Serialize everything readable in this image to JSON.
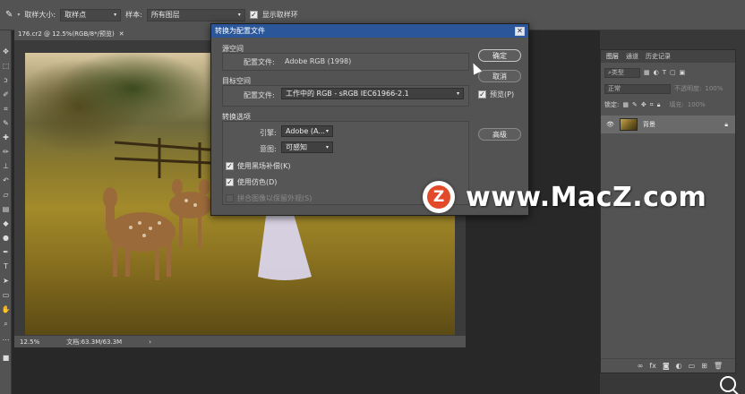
{
  "options_bar": {
    "sample_size_label": "取样大小:",
    "sample_size_value": "取样点",
    "sample_label": "样本:",
    "sample_value": "所有图层",
    "show_ring_label": "显示取样环"
  },
  "document": {
    "tab_title": "176.cr2 @ 12.5%(RGB/8*/预览)",
    "zoom": "12.5%",
    "doc_info": "文档:63.3M/63.3M"
  },
  "dialog": {
    "title": "转换为配置文件",
    "source_group": "源空间",
    "source_profile_label": "配置文件:",
    "source_profile_value": "Adobe RGB (1998)",
    "target_group": "目标空间",
    "target_profile_label": "配置文件:",
    "target_profile_value": "工作中的 RGB - sRGB IEC61966-2.1",
    "options_group": "转换选项",
    "engine_label": "引擎:",
    "engine_value": "Adobe (A...",
    "intent_label": "意图:",
    "intent_value": "可感知",
    "use_bpc": "使用黑场补偿(K)",
    "use_dither": "使用仿色(D)",
    "flatten": "拼合图像以保留外观(S)",
    "ok": "确定",
    "cancel": "取消",
    "preview": "预览(P)",
    "advanced": "高级"
  },
  "layers_panel": {
    "tabs": [
      "图层",
      "通道",
      "历史记录"
    ],
    "filter_kind": "类型",
    "blend_mode": "正常",
    "opacity_label": "不透明度:",
    "opacity_value": "100%",
    "lock_label": "锁定:",
    "fill_label": "填充:",
    "fill_value": "100%",
    "layer_name": "背景"
  },
  "watermark": {
    "logo_letter": "Z",
    "text": "www.MacZ.com"
  },
  "colors": {
    "dialog_title_bg": "#2b579a",
    "watermark_logo": "#e24a2a"
  }
}
